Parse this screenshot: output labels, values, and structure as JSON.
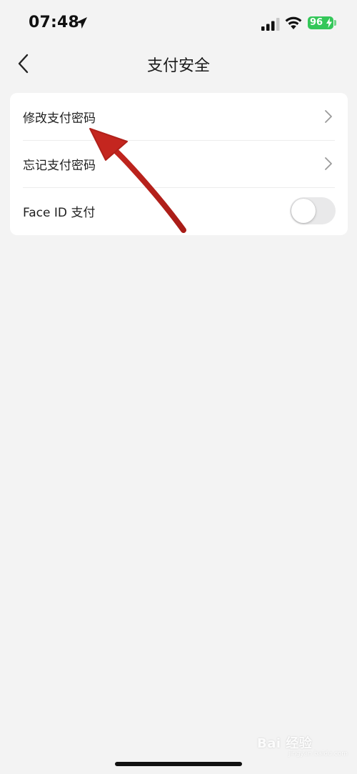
{
  "status_bar": {
    "time": "07:48",
    "battery_level": "96",
    "icons": [
      "location-arrow-icon",
      "cellular-signal-icon",
      "wifi-icon",
      "battery-charging-icon"
    ]
  },
  "nav": {
    "title": "支付安全",
    "back_icon": "chevron-left-icon"
  },
  "settings": {
    "items": [
      {
        "label": "修改支付密码",
        "control": "chevron-right-icon"
      },
      {
        "label": "忘记支付密码",
        "control": "chevron-right-icon"
      },
      {
        "label": "Face ID 支付",
        "control": "toggle",
        "toggle_on": false
      }
    ]
  },
  "annotation": {
    "type": "arrow",
    "color": "#c4261f",
    "points_to": "修改支付密码"
  },
  "watermark": {
    "text": "Bai 经验",
    "url": "jingyan.baidu.com"
  },
  "colors": {
    "background": "#f3f3f3",
    "card": "#ffffff",
    "battery": "#34c759",
    "toggle_off": "#e9e9ea"
  }
}
